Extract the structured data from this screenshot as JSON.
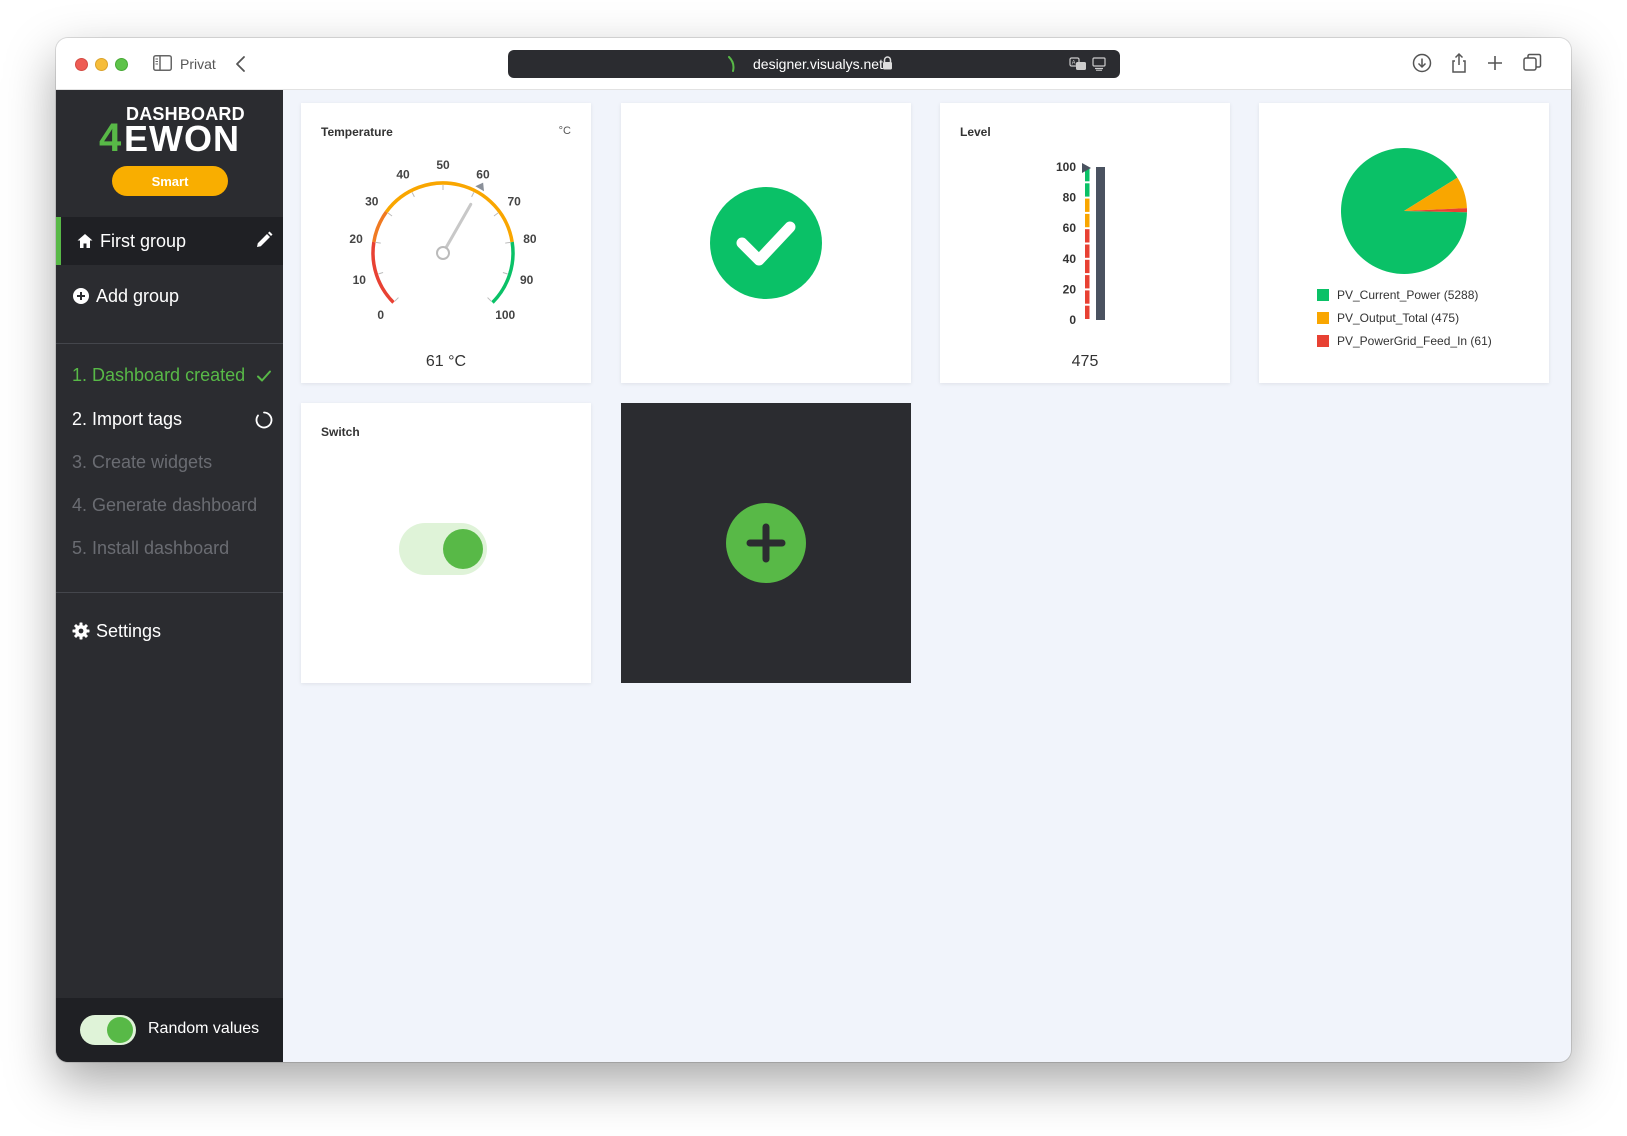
{
  "browser": {
    "profile": "Privat",
    "url": "designer.visualys.net"
  },
  "sidebar": {
    "logo": {
      "top": "DASHBOARD",
      "four": "4",
      "ewon": "EWON"
    },
    "badge": "Smart",
    "groups": [
      {
        "label": "First group",
        "icon": "home-icon",
        "active": true
      },
      {
        "label": "Add group",
        "icon": "plus-circle-icon",
        "active": false
      }
    ],
    "steps": [
      {
        "label": "1. Dashboard created",
        "state": "done"
      },
      {
        "label": "2. Import tags",
        "state": "current"
      },
      {
        "label": "3. Create widgets",
        "state": "pending"
      },
      {
        "label": "4. Generate dashboard",
        "state": "pending"
      },
      {
        "label": "5. Install dashboard",
        "state": "pending"
      }
    ],
    "settings": "Settings",
    "random_values": {
      "label": "Random values",
      "on": true
    }
  },
  "colors": {
    "accent": "#58b947",
    "sidebar_bg": "#2b2c30",
    "badge": "#f9ae00",
    "content_bg": "#f1f4fb",
    "gauge_red": "#e84133",
    "gauge_orange": "#f9a600",
    "gauge_green": "#0ac167"
  },
  "widgets": {
    "temperature": {
      "title": "Temperature",
      "unit": "°C",
      "ticks": [
        "0",
        "10",
        "20",
        "30",
        "40",
        "50",
        "60",
        "70",
        "80",
        "90",
        "100"
      ],
      "min": 0,
      "max": 100,
      "value": 61,
      "value_text": "61 °C"
    },
    "status": {
      "state": "ok",
      "icon": "checkmark-icon"
    },
    "level": {
      "title": "Level",
      "ticks": [
        "100",
        "80",
        "60",
        "40",
        "20",
        "0"
      ],
      "min": 0,
      "max": 100,
      "value_text": "475"
    },
    "pie": {
      "legend": [
        {
          "label": "PV_Current_Power (5288)",
          "value": 5288,
          "color": "#0ac167"
        },
        {
          "label": "PV_Output_Total (475)",
          "value": 475,
          "color": "#f9a600"
        },
        {
          "label": "PV_PowerGrid_Feed_In (61)",
          "value": 61,
          "color": "#e84133"
        }
      ]
    },
    "switch": {
      "title": "Switch",
      "on": true
    }
  }
}
